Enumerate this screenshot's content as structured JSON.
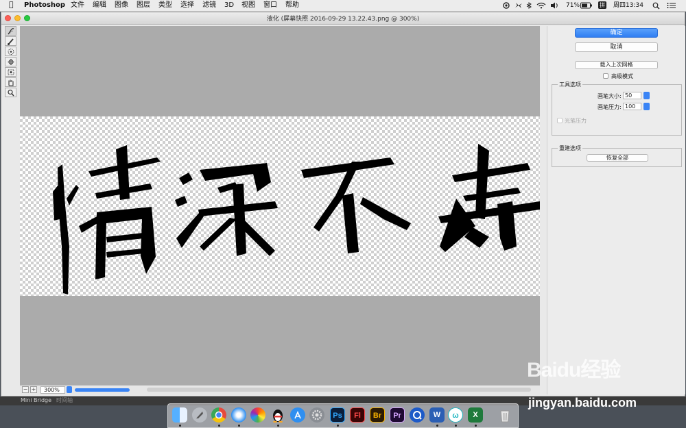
{
  "menubar": {
    "app_name": "Photoshop",
    "items": [
      "文件",
      "编辑",
      "图像",
      "图层",
      "类型",
      "选择",
      "滤镜",
      "3D",
      "视图",
      "窗口",
      "帮助"
    ],
    "battery": "71%",
    "clock": "周四13:34",
    "input_method": "拼"
  },
  "window": {
    "title": "液化 (屏幕快照 2016-09-29 13.22.43.png @ 300%)"
  },
  "canvas": {
    "calligraphy_text": "情深不寿",
    "zoom": "300%"
  },
  "panel": {
    "ok_label": "确定",
    "cancel_label": "取消",
    "load_mesh_label": "载入上次网格",
    "advanced_mode_label": "高级模式",
    "tool_options": {
      "title": "工具选项",
      "brush_size_label": "画笔大小:",
      "brush_size_value": "50",
      "brush_pressure_label": "画笔压力:",
      "brush_pressure_value": "100",
      "stylus_label": "光笔压力"
    },
    "reconstruct": {
      "title": "重建选项",
      "restore_all_label": "恢复全部"
    }
  },
  "bottom_tabs": [
    "Mini Bridge",
    "时间轴"
  ],
  "dock": {
    "apps": [
      {
        "name": "finder",
        "label": "",
        "color": "#2d7ff0"
      },
      {
        "name": "launchpad",
        "label": "",
        "color": "#9aa0a8"
      },
      {
        "name": "chrome",
        "label": "",
        "color": "#e64a3c"
      },
      {
        "name": "safari",
        "label": "",
        "color": "#2a8cf0"
      },
      {
        "name": "photos",
        "label": "",
        "color": "#f2a43a"
      },
      {
        "name": "qq",
        "label": "",
        "color": "#111111"
      },
      {
        "name": "app-store",
        "label": "",
        "color": "#2f8ff0"
      },
      {
        "name": "system-preferences",
        "label": "",
        "color": "#8a8e94"
      },
      {
        "name": "photoshop",
        "label": "Ps",
        "color": "#0b1e3a"
      },
      {
        "name": "flash",
        "label": "Fl",
        "color": "#3a0505"
      },
      {
        "name": "bridge",
        "label": "Br",
        "color": "#2b1b05"
      },
      {
        "name": "premiere",
        "label": "Pr",
        "color": "#1f0a33"
      },
      {
        "name": "quicktime",
        "label": "",
        "color": "#1d5ac8"
      },
      {
        "name": "word",
        "label": "W",
        "color": "#2b5fb4"
      },
      {
        "name": "wunderlist",
        "label": "ω",
        "color": "#ffffff"
      },
      {
        "name": "excel",
        "label": "X",
        "color": "#1f7a3c"
      },
      {
        "name": "trash",
        "label": "",
        "color": "#e6e6e6"
      }
    ]
  },
  "watermark": {
    "logo": "Baidu经验",
    "url": "jingyan.baidu.com"
  }
}
